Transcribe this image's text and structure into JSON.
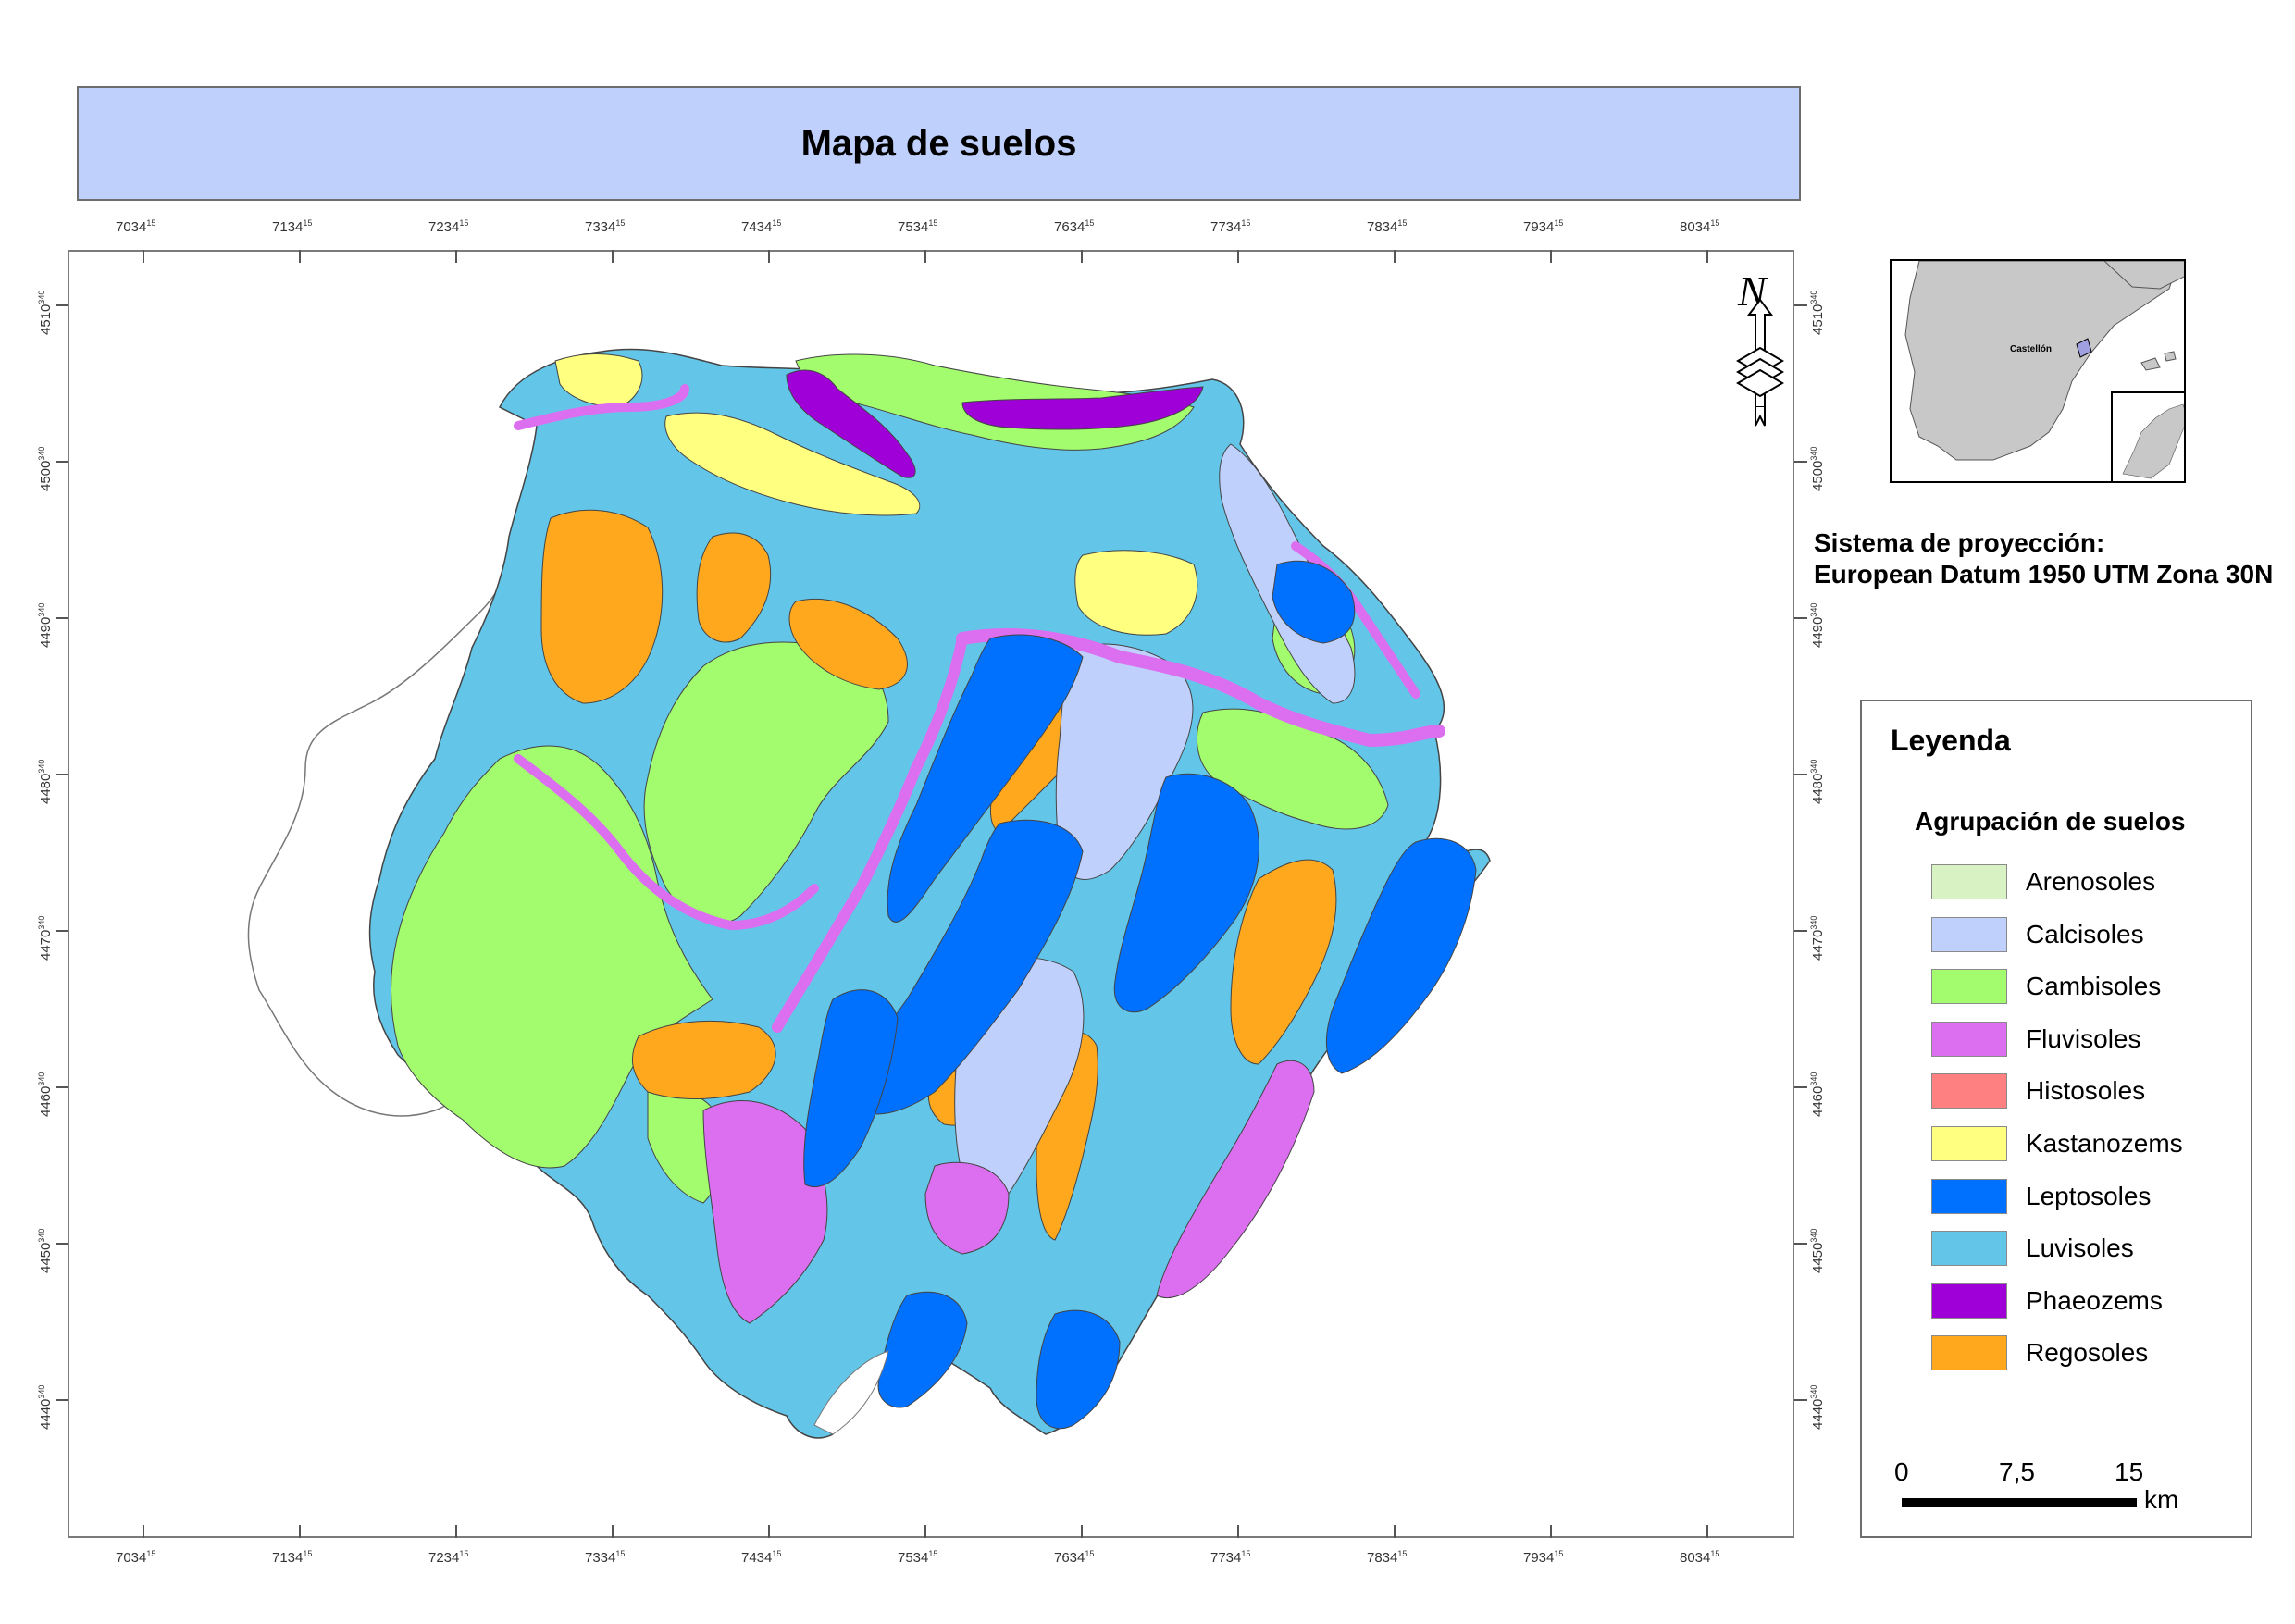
{
  "title": "Mapa de suelos",
  "x_ticks": [
    "7034",
    "7134",
    "7234",
    "7334",
    "7434",
    "7534",
    "7634",
    "7734",
    "7834",
    "7934",
    "8034"
  ],
  "x_tick_sup": "15",
  "y_ticks": [
    "4510",
    "4500",
    "4490",
    "4480",
    "4470",
    "4460",
    "4450",
    "4440"
  ],
  "y_tick_sup": "340",
  "north_arrow": {
    "letter": "N",
    "icon": "north-arrow-icon"
  },
  "inset_map": {
    "label": "Castellón"
  },
  "projection": {
    "line1": "Sistema de proyección:",
    "line2": "European Datum 1950 UTM Zona 30N"
  },
  "legend": {
    "title": "Leyenda",
    "subtitle": "Agrupación de suelos",
    "items": [
      {
        "label": "Arenosoles",
        "color": "#d9f2c3"
      },
      {
        "label": "Calcisoles",
        "color": "#c0d0fc"
      },
      {
        "label": "Cambisoles",
        "color": "#a3fc6e"
      },
      {
        "label": "Fluvisoles",
        "color": "#dc6ef0"
      },
      {
        "label": "Histosoles",
        "color": "#ff8080"
      },
      {
        "label": "Kastanozems",
        "color": "#ffff80"
      },
      {
        "label": "Leptosoles",
        "color": "#0070ff"
      },
      {
        "label": "Luvisoles",
        "color": "#63c6e8"
      },
      {
        "label": "Phaeozems",
        "color": "#a000d8"
      },
      {
        "label": "Regosoles",
        "color": "#ffa81e"
      }
    ]
  },
  "scale_bar": {
    "labels": [
      "0",
      "7,5",
      "15"
    ],
    "unit": "km"
  }
}
